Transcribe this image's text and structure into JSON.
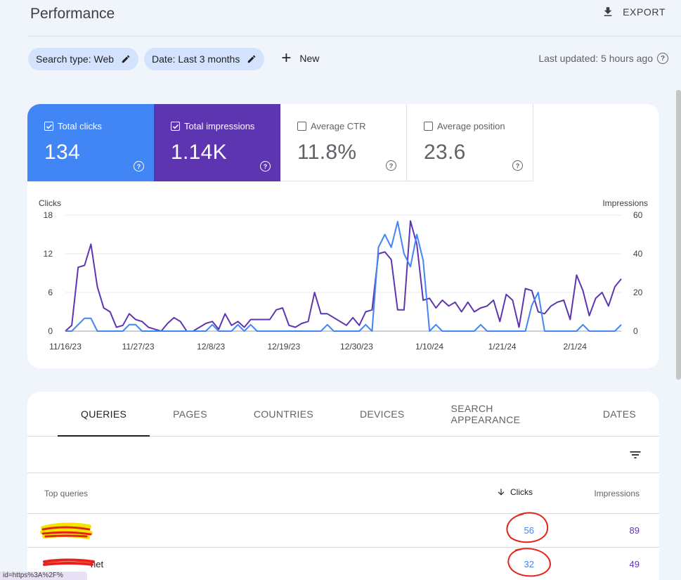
{
  "header": {
    "title": "Performance",
    "export_label": "EXPORT"
  },
  "filters": {
    "search_type": "Search type: Web",
    "date": "Date: Last 3 months",
    "new_label": "New",
    "last_updated": "Last updated: 5 hours ago"
  },
  "metrics": [
    {
      "label": "Total clicks",
      "value": "134",
      "checked": true
    },
    {
      "label": "Total impressions",
      "value": "1.14K",
      "checked": true
    },
    {
      "label": "Average CTR",
      "value": "11.8%",
      "checked": false
    },
    {
      "label": "Average position",
      "value": "23.6",
      "checked": false
    }
  ],
  "colors": {
    "clicks": "#4285f4",
    "impressions": "#5e35b1",
    "accent_chip": "#d3e3fd"
  },
  "chart_data": {
    "type": "line",
    "left_axis_label": "Clicks",
    "right_axis_label": "Impressions",
    "y_left_ticks": [
      "18",
      "12",
      "6",
      "0"
    ],
    "y_right_ticks": [
      "60",
      "40",
      "20",
      "0"
    ],
    "ylim_left": [
      0,
      18
    ],
    "ylim_right": [
      0,
      60
    ],
    "x_tick_labels": [
      "11/16/23",
      "11/27/23",
      "12/8/23",
      "12/19/23",
      "12/30/23",
      "1/10/24",
      "1/21/24",
      "2/1/24"
    ],
    "series": [
      {
        "name": "Impressions",
        "axis": "right",
        "values": [
          0,
          3,
          33,
          34,
          45,
          23,
          12,
          10,
          2,
          3,
          9,
          6,
          5,
          2,
          1,
          0,
          4,
          7,
          5,
          0,
          0,
          2,
          4,
          5,
          1,
          9,
          3,
          5,
          2,
          6,
          6,
          6,
          6,
          11,
          12,
          3,
          2,
          4,
          5,
          20,
          9,
          9,
          7,
          5,
          3,
          7,
          3,
          10,
          11,
          40,
          41,
          37,
          11,
          11,
          57,
          45,
          16,
          17,
          12,
          16,
          13,
          15,
          10,
          15,
          10,
          12,
          13,
          16,
          5,
          19,
          16,
          2,
          22,
          21,
          10,
          9,
          13,
          15,
          16,
          6,
          29,
          21,
          8,
          17,
          20,
          13,
          23,
          27
        ]
      },
      {
        "name": "Clicks",
        "axis": "left",
        "values": [
          0,
          0,
          1,
          2,
          2,
          0,
          0,
          0,
          0,
          0,
          1,
          1,
          0,
          0,
          0,
          0,
          0,
          0,
          0,
          0,
          0,
          0,
          0,
          1,
          0,
          0,
          0,
          1,
          0,
          1,
          0,
          0,
          0,
          0,
          0,
          0,
          0,
          0,
          0,
          0,
          0,
          1,
          0,
          0,
          0,
          0,
          0,
          1,
          0,
          13,
          15,
          13,
          17,
          12,
          10,
          15,
          11,
          0,
          1,
          0,
          0,
          0,
          0,
          0,
          0,
          1,
          0,
          0,
          0,
          0,
          0,
          0,
          0,
          4,
          6,
          0,
          0,
          0,
          0,
          0,
          0,
          1,
          0,
          0,
          0,
          0,
          0,
          1
        ]
      }
    ]
  },
  "tabs": [
    "QUERIES",
    "PAGES",
    "COUNTRIES",
    "DEVICES",
    "SEARCH APPEARANCE",
    "DATES"
  ],
  "table": {
    "col_query": "Top queries",
    "col_clicks": "Clicks",
    "col_impressions": "Impressions",
    "rows": [
      {
        "query": "",
        "clicks": "56",
        "impressions": "89"
      },
      {
        "query": "net",
        "clicks": "32",
        "impressions": "49"
      }
    ]
  },
  "statusbar": {
    "text": "id=https%3A%2F%"
  }
}
